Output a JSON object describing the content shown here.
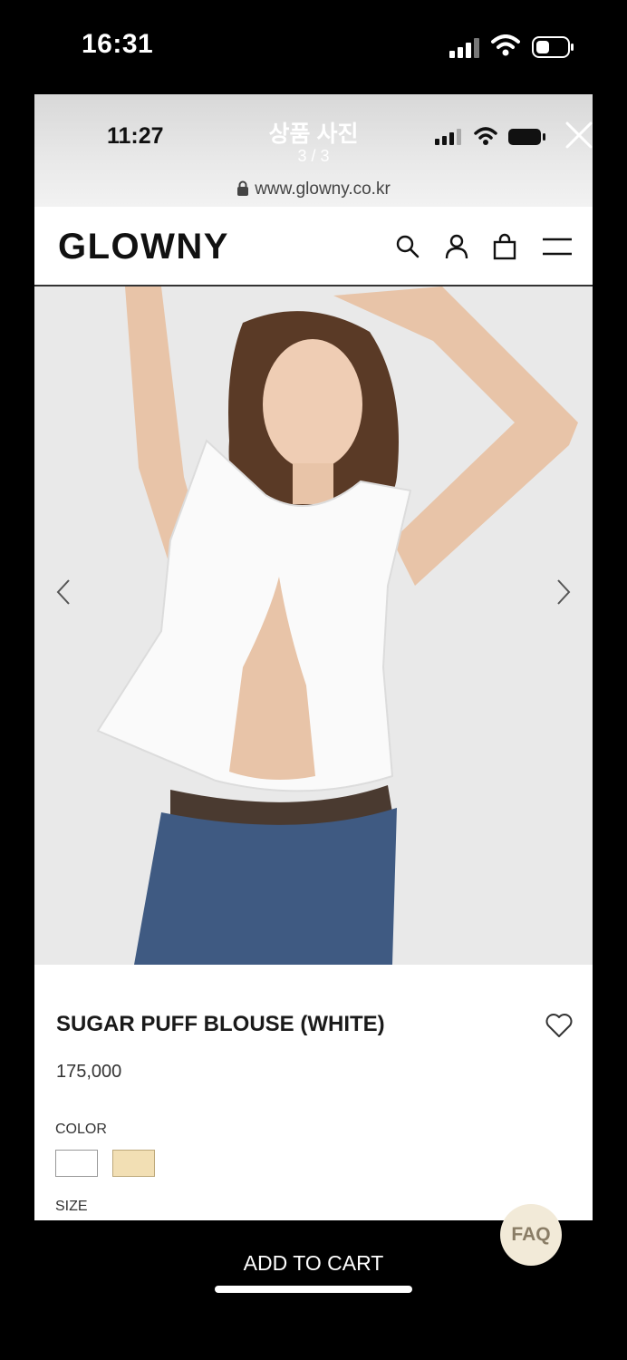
{
  "outer_status": {
    "time": "16:31"
  },
  "viewer": {
    "status_time": "11:27",
    "title": "상품 사진",
    "counter": "3 / 3",
    "url": "www.glowny.co.kr"
  },
  "site": {
    "logo": "GLOWNY"
  },
  "product": {
    "name": "SUGAR PUFF BLOUSE (WHITE)",
    "price": "175,000",
    "color_label": "COLOR",
    "colors": [
      "#ffffff",
      "#f2dfb4"
    ],
    "size_label": "SIZE"
  },
  "faq_label": "FAQ",
  "bottom_action": "ADD TO CART"
}
